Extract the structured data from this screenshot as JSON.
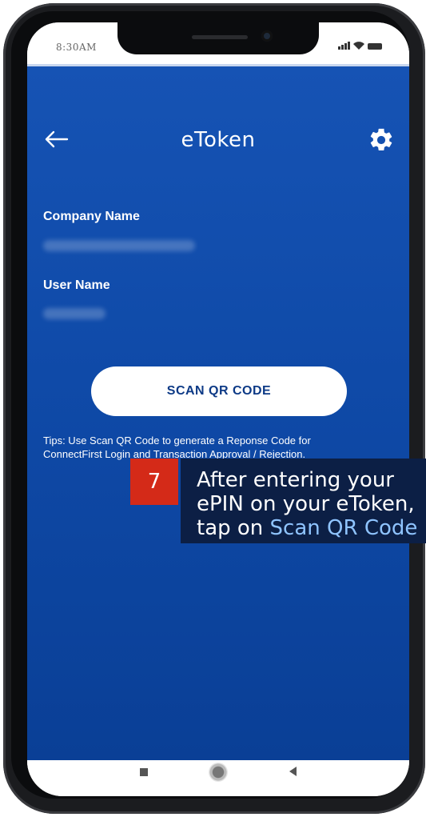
{
  "status_bar": {
    "time": "8:30AM"
  },
  "header": {
    "title": "eToken",
    "back_icon": "arrow-left-icon",
    "settings_icon": "gear-icon"
  },
  "fields": {
    "company_label": "Company Name",
    "user_label": "User Name"
  },
  "scan_button": {
    "label": "SCAN QR CODE"
  },
  "tips": {
    "line1": "Tips: Use Scan QR Code to generate a Reponse Code for",
    "line2": "ConnectFirst Login and Transaction Approval / Rejection."
  },
  "callout": {
    "step": "7",
    "line1": "After entering your",
    "line2": "ePIN on your eToken,",
    "line3_prefix": "tap on ",
    "line3_highlight": "Scan QR Code"
  },
  "colors": {
    "app_background": "#1653b4",
    "button_text": "#0d3a86",
    "callout_number_bg": "#d42a18",
    "callout_bg": "#0c1f45",
    "callout_highlight": "#8fc4ff"
  }
}
